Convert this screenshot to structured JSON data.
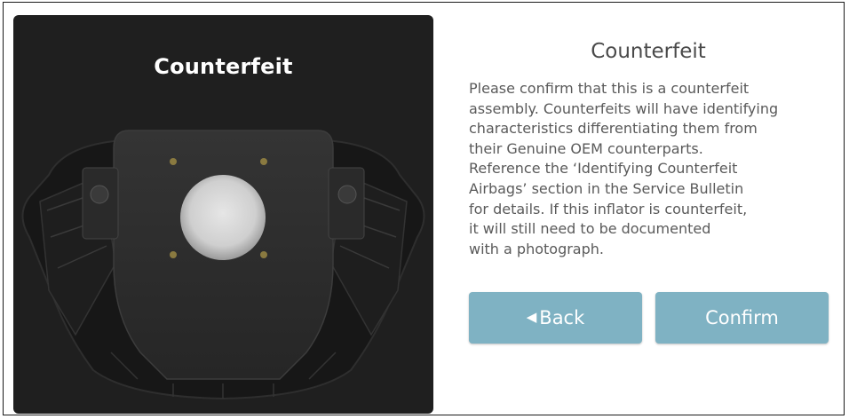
{
  "image_panel": {
    "title": "Counterfeit",
    "image_subject": "steering-wheel-airbag-assembly"
  },
  "info": {
    "title": "Counterfeit",
    "body_lines": [
      "Please confirm that this is a counterfeit",
      "assembly. Counterfeits will have identifying",
      "characteristics differentiating them from",
      "their Genuine OEM counterparts.",
      "Reference the ‘Identifying Counterfeit",
      "Airbags’ section in the Service Bulletin",
      "for details. If this inflator is counterfeit,",
      "it will still need to be documented",
      "with a photograph."
    ]
  },
  "buttons": {
    "back_icon": "◀",
    "back_label": "Back",
    "confirm_label": "Confirm"
  },
  "colors": {
    "button_bg": "#7fb2c3",
    "image_panel_bg": "#1f1f1f",
    "text": "#5a5a5a"
  }
}
